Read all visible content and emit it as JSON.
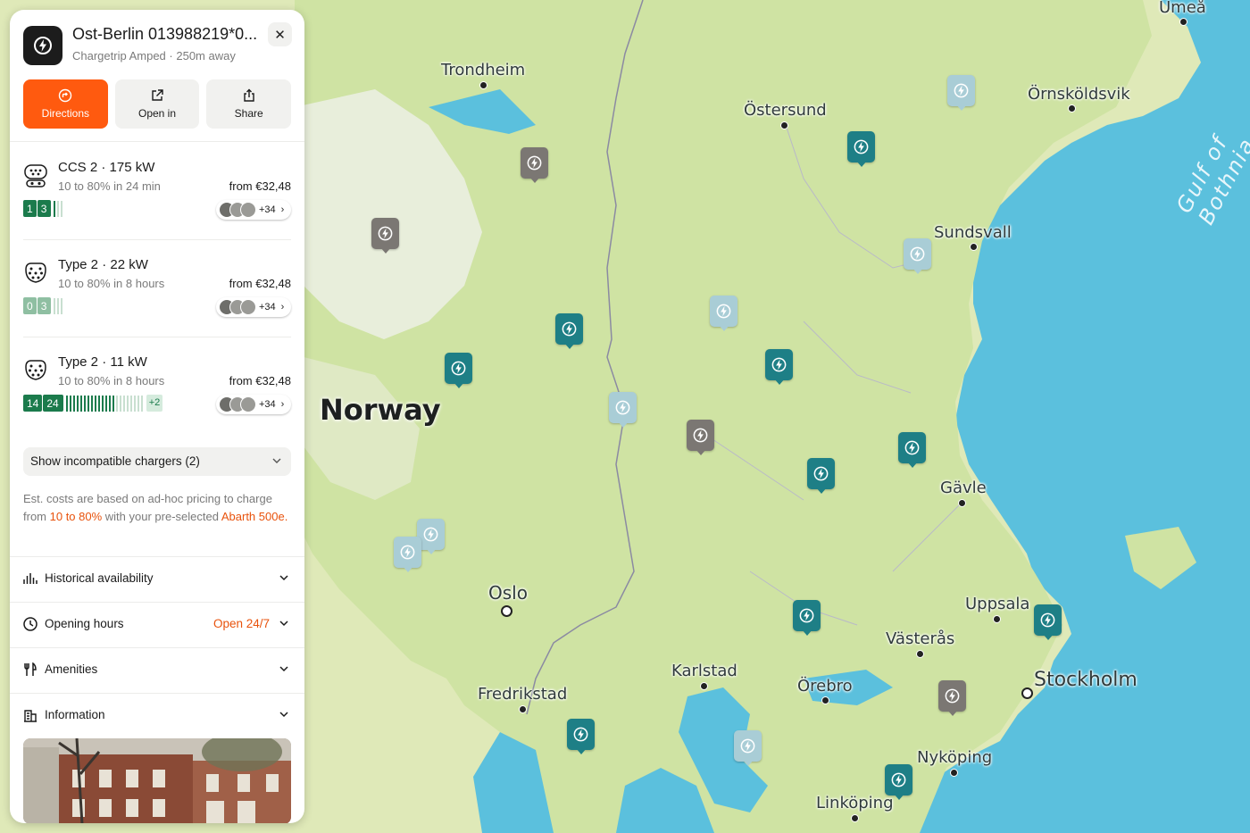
{
  "station": {
    "title": "Ost-Berlin 013988219*0...",
    "operator": "Chargetrip Amped",
    "distance": "250m away",
    "close_icon": "close-icon"
  },
  "actions": [
    {
      "label": "Directions",
      "icon": "directions-icon"
    },
    {
      "label": "Open in",
      "icon": "external-link-icon"
    },
    {
      "label": "Share",
      "icon": "share-icon"
    }
  ],
  "connectors": [
    {
      "name": "CCS 2 · 175 kW",
      "time": "10 to 80% in 24 min",
      "price": "from €32,48",
      "available": "1",
      "total": "3",
      "cards": "+34",
      "extra": ""
    },
    {
      "name": "Type 2 · 22 kW",
      "time": "10 to 80% in 8 hours",
      "price": "from €32,48",
      "available": "0",
      "total": "3",
      "cards": "+34",
      "extra": ""
    },
    {
      "name": "Type 2 · 11 kW",
      "time": "10 to 80% in 8 hours",
      "price": "from €32,48",
      "available": "14",
      "total": "24",
      "cards": "+34",
      "extra": "+2"
    }
  ],
  "incompatible": {
    "label": "Show incompatible chargers (2)"
  },
  "note": {
    "part1": "Est. costs are based on ad-hoc pricing to charge from ",
    "range": "10 to 80%",
    "part2": " with your pre-selected ",
    "vehicle": "Abarth 500e."
  },
  "sections": [
    {
      "label": "Historical availability",
      "value": "",
      "icon": "chart-icon"
    },
    {
      "label": "Opening hours",
      "value": "Open 24/7",
      "icon": "clock-icon"
    },
    {
      "label": "Amenities",
      "value": "",
      "icon": "cutlery-icon"
    },
    {
      "label": "Information",
      "value": "",
      "icon": "building-icon"
    }
  ],
  "map": {
    "country": "Norway",
    "sea": "Gulf of Bothnia",
    "cities": [
      "Trondheim",
      "Östersund",
      "Örnsköldsvik",
      "Umeå",
      "Sundsvall",
      "Gävle",
      "Uppsala",
      "Västerås",
      "Stockholm",
      "Oslo",
      "Karlstad",
      "Örebro",
      "Fredrikstad",
      "Nyköping",
      "Linköping"
    ],
    "pin_colors": {
      "available": "#1e7f86",
      "occupied": "#7b7773",
      "unknown": "#a9cdd6"
    },
    "accent": "#ff5a0f"
  }
}
